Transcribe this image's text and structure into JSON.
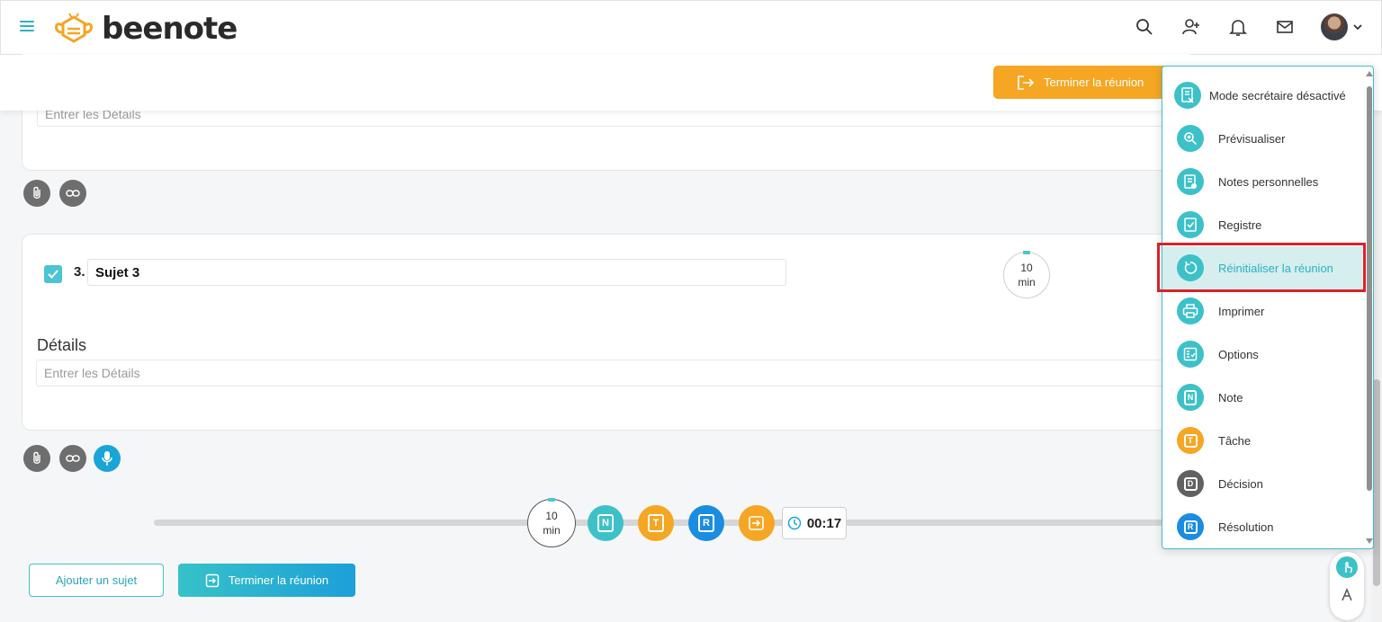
{
  "header": {
    "brand": "beenote",
    "icons": [
      "search-icon",
      "add-user-icon",
      "bell-icon",
      "mail-icon"
    ]
  },
  "topbar": {
    "end_meeting_label": "Terminer la réunion"
  },
  "topic_prev": {
    "details_placeholder": "Entrer les Détails"
  },
  "topic": {
    "number": "3.",
    "title": "Sujet 3",
    "checked": true,
    "timer_value": "10",
    "timer_unit": "min",
    "details_label": "Détails",
    "details_placeholder": "Entrer les Détails"
  },
  "toolbar": {
    "timer_value": "10",
    "timer_unit": "min",
    "note_letter": "N",
    "task_letter": "T",
    "resolution_letter": "R",
    "elapsed": "00:17"
  },
  "footer": {
    "add_topic_label": "Ajouter un sujet",
    "end_meeting_label": "Terminer la réunion"
  },
  "menu": {
    "items": [
      {
        "label": "Mode secrétaire désactivé",
        "icon": "secretary-icon",
        "color": "#3dc1c9"
      },
      {
        "label": "Prévisualiser",
        "icon": "zoom-icon",
        "color": "#3dc1c9"
      },
      {
        "label": "Notes personnelles",
        "icon": "personal-notes-icon",
        "color": "#3dc1c9"
      },
      {
        "label": "Registre",
        "icon": "register-icon",
        "color": "#3dc1c9"
      },
      {
        "label": "Réinitialiser la réunion",
        "icon": "reset-icon",
        "color": "#3dc1c9",
        "active": true
      },
      {
        "label": "Imprimer",
        "icon": "print-icon",
        "color": "#3dc1c9"
      },
      {
        "label": "Options",
        "icon": "options-icon",
        "color": "#3dc1c9"
      },
      {
        "label": "Note",
        "icon": "note-icon",
        "color": "#3dc1c9",
        "letter": "N"
      },
      {
        "label": "Tâche",
        "icon": "task-icon",
        "color": "#f5a623",
        "letter": "T"
      },
      {
        "label": "Décision",
        "icon": "decision-icon",
        "color": "#616161",
        "letter": "D"
      },
      {
        "label": "Résolution",
        "icon": "resolution-icon",
        "color": "#1a8de0",
        "letter": "R"
      }
    ]
  },
  "colors": {
    "accent": "#3dc1c9",
    "orange": "#f5a623",
    "blue": "#1a8de0",
    "highlight": "#d9222a"
  }
}
